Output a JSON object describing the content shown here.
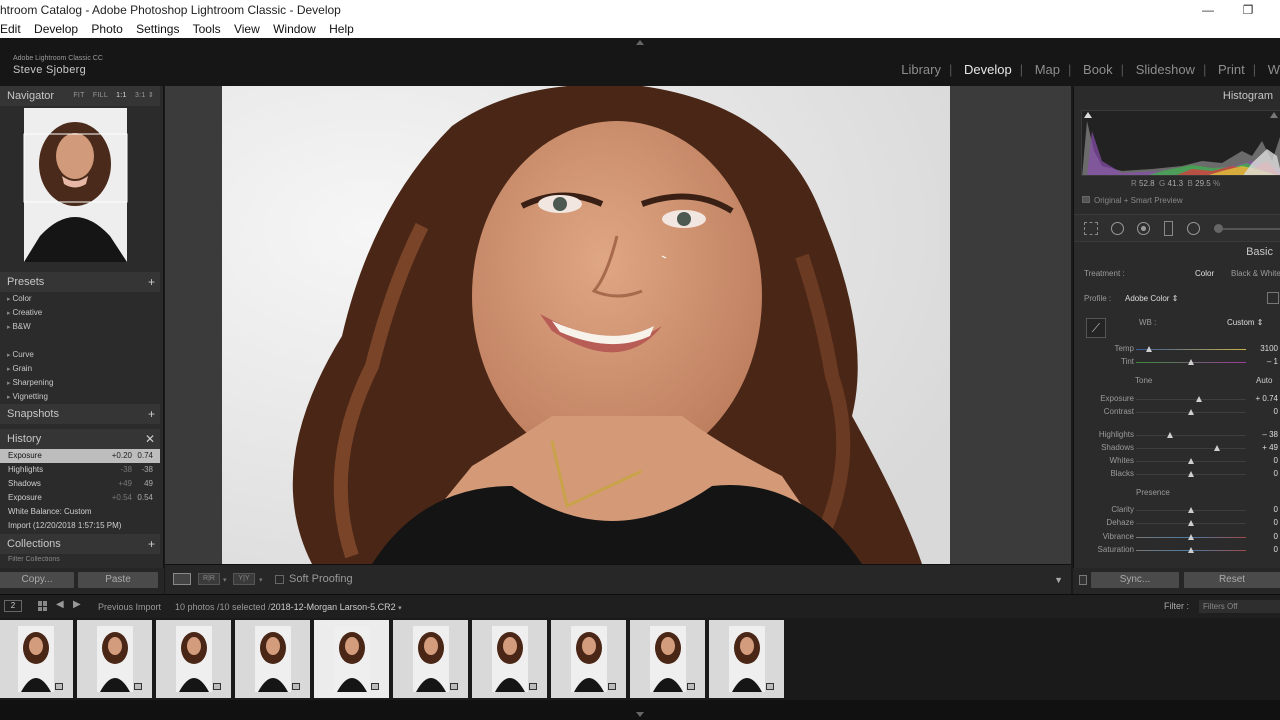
{
  "window": {
    "title": "htroom Catalog - Adobe Photoshop Lightroom Classic - Develop",
    "minimize": "—",
    "restore": "❐"
  },
  "menu": [
    "Edit",
    "Develop",
    "Photo",
    "Settings",
    "Tools",
    "View",
    "Window",
    "Help"
  ],
  "identity": {
    "product": "Adobe Lightroom Classic CC",
    "user": "Steve Sjoberg"
  },
  "modules": [
    "Library",
    "Develop",
    "Map",
    "Book",
    "Slideshow",
    "Print",
    "W"
  ],
  "active_module": "Develop",
  "navigator": {
    "title": "Navigator",
    "opts": [
      "FIT",
      "FILL",
      "1:1",
      "3:1 ⇕"
    ]
  },
  "presets": {
    "title": "Presets",
    "groups": [
      "Color",
      "Creative",
      "B&W",
      "Curve",
      "Grain",
      "Sharpening",
      "Vignetting"
    ]
  },
  "snapshots": {
    "title": "Snapshots"
  },
  "history": {
    "title": "History",
    "items": [
      {
        "label": "Exposure",
        "a": "+0.20",
        "b": "0.74",
        "selected": true
      },
      {
        "label": "Highlights",
        "a": "-38",
        "b": "-38"
      },
      {
        "label": "Shadows",
        "a": "+49",
        "b": "49"
      },
      {
        "label": "Exposure",
        "a": "+0.54",
        "b": "0.54"
      },
      {
        "label": "White Balance: Custom",
        "a": "",
        "b": ""
      },
      {
        "label": "Import (12/20/2018 1:57:15 PM)",
        "a": "",
        "b": ""
      }
    ]
  },
  "collections": {
    "title": "Collections",
    "filter": "Filter Collections"
  },
  "left_buttons": {
    "copy": "Copy...",
    "paste": "Paste"
  },
  "toolbar": {
    "soft_proofing": "Soft Proofing"
  },
  "histogram": {
    "title": "Histogram",
    "r_label": "R",
    "r": "52.8",
    "g_label": "G",
    "g": "41.3",
    "b_label": "B",
    "b": "29.5",
    "pct": "%",
    "preview": "Original + Smart Preview"
  },
  "basic": {
    "title": "Basic",
    "treatment_label": "Treatment :",
    "treatment_color": "Color",
    "treatment_bw": "Black & White",
    "profile_label": "Profile :",
    "profile_value": "Adobe Color ⇕",
    "wb_label": "WB :",
    "wb_value": "Custom ⇕",
    "tone_label": "Tone",
    "auto_label": "Auto",
    "presence_label": "Presence",
    "sliders": [
      {
        "label": "Temp",
        "value": "3100",
        "pos": 0.12
      },
      {
        "label": "Tint",
        "value": "– 1",
        "pos": 0.5
      },
      {
        "label": "Exposure",
        "value": "+ 0.74",
        "pos": 0.57
      },
      {
        "label": "Contrast",
        "value": "0",
        "pos": 0.5
      },
      {
        "label": "Highlights",
        "value": "– 38",
        "pos": 0.31
      },
      {
        "label": "Shadows",
        "value": "+ 49",
        "pos": 0.74
      },
      {
        "label": "Whites",
        "value": "0",
        "pos": 0.5
      },
      {
        "label": "Blacks",
        "value": "0",
        "pos": 0.5
      },
      {
        "label": "Clarity",
        "value": "0",
        "pos": 0.5
      },
      {
        "label": "Dehaze",
        "value": "0",
        "pos": 0.5
      },
      {
        "label": "Vibrance",
        "value": "0",
        "pos": 0.5
      },
      {
        "label": "Saturation",
        "value": "0",
        "pos": 0.5
      }
    ]
  },
  "right_buttons": {
    "sync": "Sync...",
    "reset": "Reset"
  },
  "filmstrip": {
    "page": "2",
    "source": "Previous Import",
    "count": "10 photos /10 selected /",
    "filename": "2018-12-Morgan Larson-5.CR2",
    "filter_label": "Filter :",
    "filter_value": "Filters Off",
    "thumb_count": 10
  },
  "colors": {
    "accent": "#e8e8e8",
    "panel": "#2b2b2b",
    "selected_history": "#bdbdbd"
  }
}
